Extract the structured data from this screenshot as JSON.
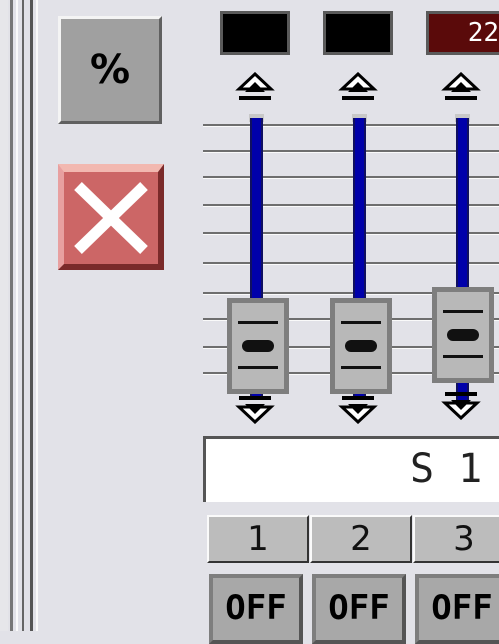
{
  "side_buttons": {
    "percent": {
      "label": "%",
      "icon": "percent-icon"
    },
    "close": {
      "icon": "close-x-icon",
      "color": "#cc6666"
    }
  },
  "channels": [
    {
      "display": "",
      "level": 0.0,
      "number": "1",
      "toggle": "OFF",
      "active": false
    },
    {
      "display": "",
      "level": 0.0,
      "number": "2",
      "toggle": "OFF",
      "active": false
    },
    {
      "display": "22",
      "level": 0.06,
      "number": "3",
      "toggle": "OFF",
      "active": true
    }
  ],
  "label_field": {
    "value": "S 1"
  },
  "colors": {
    "background": "#e2e2e8",
    "track": "#0000aa",
    "active_display": "#5a0a0a",
    "display": "#000000"
  }
}
